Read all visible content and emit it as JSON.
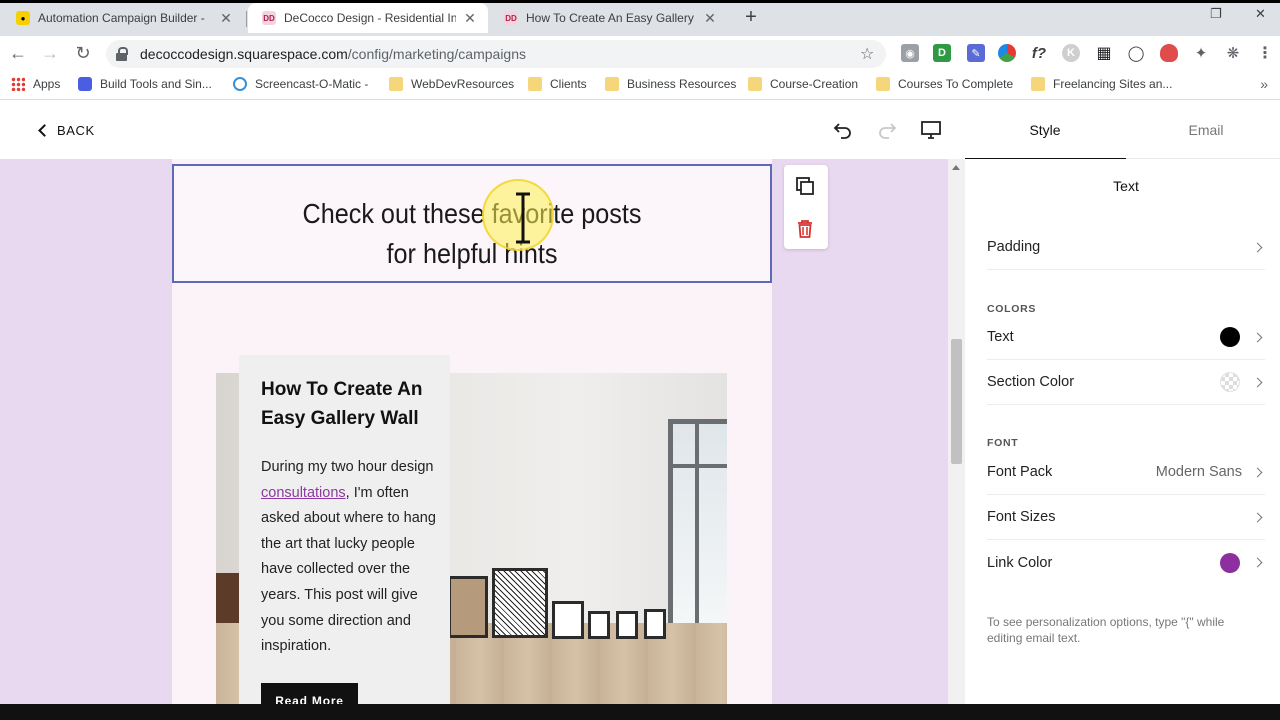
{
  "browser": {
    "tabs": [
      {
        "title": "Automation Campaign Builder -",
        "favicon": "mailchimp-icon",
        "active": false
      },
      {
        "title": "DeCocco Design - Residential Int",
        "favicon": "dd-icon",
        "active": true
      },
      {
        "title": "How To Create An Easy Gallery W",
        "favicon": "dd-icon",
        "active": false
      }
    ],
    "new_tab": "+",
    "url_host": "decoccodesign.squarespace.com",
    "url_path": "/config/marketing/campaigns",
    "bookmarks": [
      {
        "label": "Apps",
        "icon": "apps-grid-icon"
      },
      {
        "label": "Build Tools and Sin...",
        "icon": "u-logo-icon"
      },
      {
        "label": "Screencast-O-Matic -",
        "icon": "screencast-icon"
      },
      {
        "label": "WebDevResources",
        "icon": "folder-icon"
      },
      {
        "label": "Clients",
        "icon": "folder-icon"
      },
      {
        "label": "Business Resources",
        "icon": "folder-icon"
      },
      {
        "label": "Course-Creation",
        "icon": "folder-icon"
      },
      {
        "label": "Courses To Complete",
        "icon": "folder-icon"
      },
      {
        "label": "Freelancing Sites an...",
        "icon": "folder-icon"
      }
    ],
    "bookmarks_more": "»"
  },
  "header": {
    "back_label": "BACK",
    "panel_tabs": [
      "Style",
      "Email"
    ]
  },
  "email": {
    "heading_line1": "Check out these favorite posts",
    "heading_line2": "for helpful hints",
    "card": {
      "title": "How To Create An Easy Gallery Wall",
      "body_before": "During my two hour design ",
      "body_link": "consultations",
      "body_after": ", I'm often asked about where to hang the art that lucky people have collected over the years.  This post will give you some direction and inspiration.",
      "button": "Read More"
    }
  },
  "panel": {
    "title": "Text",
    "padding_label": "Padding",
    "colors_section": "COLORS",
    "text_color_label": "Text",
    "text_color": "#000000",
    "section_color_label": "Section Color",
    "font_section": "FONT",
    "font_pack_label": "Font Pack",
    "font_pack_value": "Modern Sans",
    "font_sizes_label": "Font Sizes",
    "link_color_label": "Link Color",
    "link_color": "#8e2fa0",
    "hint": "To see personalization options, type \"{\" while editing email text."
  }
}
